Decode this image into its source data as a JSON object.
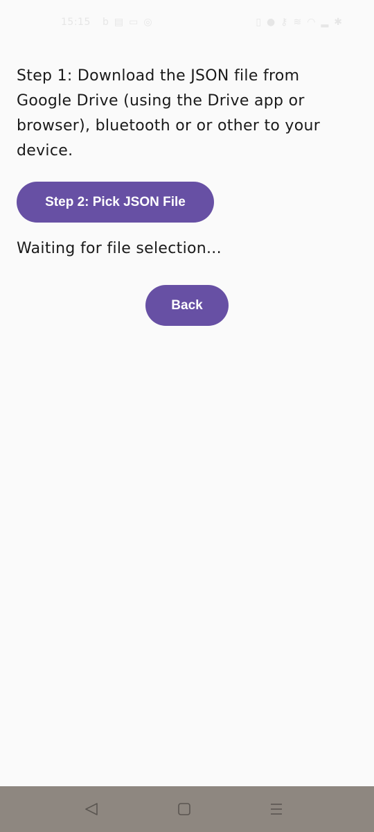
{
  "status_bar": {
    "time": "15:15",
    "icons_left": [
      "b-icon",
      "sim-icon",
      "chat-icon",
      "circle-icon"
    ],
    "icons_right": [
      "battery-icon",
      "person-icon",
      "key-icon",
      "vibrate-icon",
      "wifi-icon",
      "signal-icon",
      "bluetooth-icon"
    ]
  },
  "main": {
    "step1_text": "Step 1: Download the JSON file from Google Drive (using the Drive app or browser), bluetooth or or other to your device.",
    "pick_button_label": "Step 2: Pick JSON File",
    "status_text": "Waiting for file selection...",
    "back_button_label": "Back"
  },
  "colors": {
    "accent": "#6750a4",
    "background": "#fafafa",
    "nav_bar": "#8e8780"
  },
  "nav_bar": {
    "icons": [
      "back-triangle-icon",
      "home-square-icon",
      "recents-menu-icon"
    ]
  }
}
